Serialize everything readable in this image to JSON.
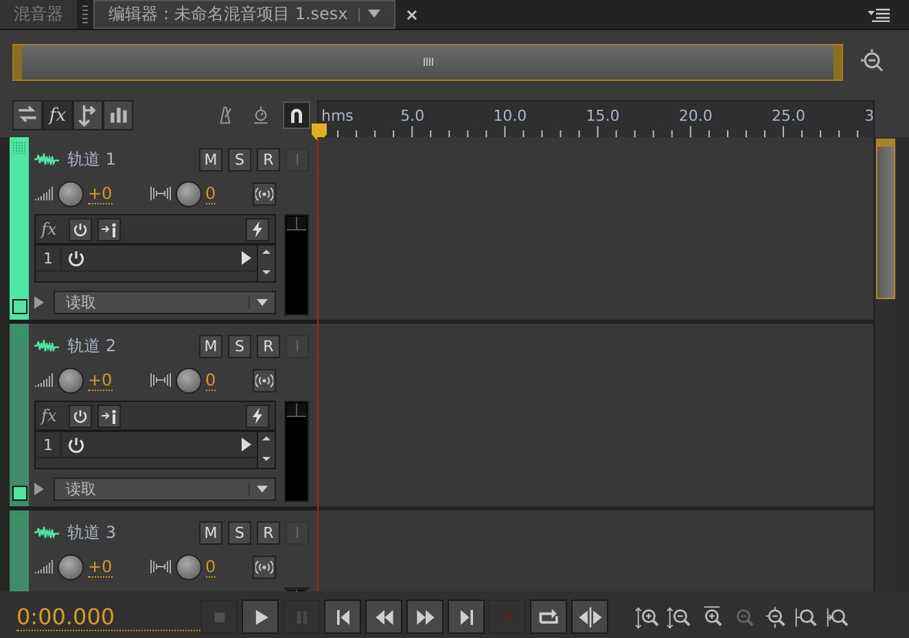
{
  "tabs": [
    {
      "label": "混音器",
      "selected": false
    },
    {
      "label": "编辑器：未命名混音项目 1.sesx",
      "selected": true
    }
  ],
  "toolbar": {
    "view_buttons": [
      {
        "kind": "io",
        "selected": false
      },
      {
        "kind": "fx",
        "label": "fx",
        "selected": true
      },
      {
        "kind": "sends",
        "selected": false
      },
      {
        "kind": "eq",
        "selected": false
      }
    ],
    "tools": [
      {
        "kind": "metronome",
        "selected": false
      },
      {
        "kind": "timer",
        "selected": false
      },
      {
        "kind": "snap",
        "selected": true
      }
    ]
  },
  "ruler": {
    "labels": [
      "hms",
      "5.0",
      "10.0",
      "15.0",
      "20.0",
      "25.0",
      "3"
    ]
  },
  "tracks": [
    {
      "name": "轨道 1",
      "color": "#4ee8a4",
      "selected": true,
      "buttons": [
        {
          "label": "M",
          "disabled": false
        },
        {
          "label": "S",
          "disabled": false
        },
        {
          "label": "R",
          "disabled": false
        },
        {
          "label": "I",
          "disabled": true
        }
      ],
      "volume": "+0",
      "pan": "0",
      "fx_label": "fx",
      "fx_slots": [
        "1"
      ],
      "mode": "读取"
    },
    {
      "name": "轨道 2",
      "color": "#4ee8a4",
      "selected": false,
      "buttons": [
        {
          "label": "M",
          "disabled": false
        },
        {
          "label": "S",
          "disabled": false
        },
        {
          "label": "R",
          "disabled": false
        },
        {
          "label": "I",
          "disabled": true
        }
      ],
      "volume": "+0",
      "pan": "0",
      "fx_label": "fx",
      "fx_slots": [
        "1"
      ],
      "mode": "读取"
    },
    {
      "name": "轨道 3",
      "selected": false,
      "buttons": [
        {
          "label": "M",
          "disabled": false
        },
        {
          "label": "S",
          "disabled": false
        },
        {
          "label": "R",
          "disabled": false
        },
        {
          "label": "I",
          "disabled": true
        }
      ],
      "volume": "+0",
      "pan": "0"
    }
  ],
  "transport": {
    "time": "0:00.000",
    "buttons": [
      {
        "kind": "stop",
        "disabled": true
      },
      {
        "kind": "play",
        "disabled": false
      },
      {
        "kind": "pause",
        "disabled": true
      },
      {
        "kind": "to-start",
        "disabled": false
      },
      {
        "kind": "rewind",
        "disabled": false
      },
      {
        "kind": "forward",
        "disabled": false
      },
      {
        "kind": "to-end",
        "disabled": false
      },
      {
        "kind": "record",
        "disabled": true
      },
      {
        "kind": "loop",
        "disabled": false
      },
      {
        "kind": "skip",
        "disabled": false
      }
    ],
    "zoom_buttons": [
      {
        "kind": "zoom-in-amp",
        "disabled": false
      },
      {
        "kind": "zoom-out-amp",
        "disabled": false
      },
      {
        "kind": "zoom-in-time",
        "disabled": false
      },
      {
        "kind": "zoom-out-time",
        "disabled": true
      },
      {
        "kind": "zoom-full",
        "disabled": false
      },
      {
        "kind": "zoom-in-point",
        "disabled": false
      },
      {
        "kind": "zoom-out-point",
        "disabled": false
      }
    ]
  }
}
